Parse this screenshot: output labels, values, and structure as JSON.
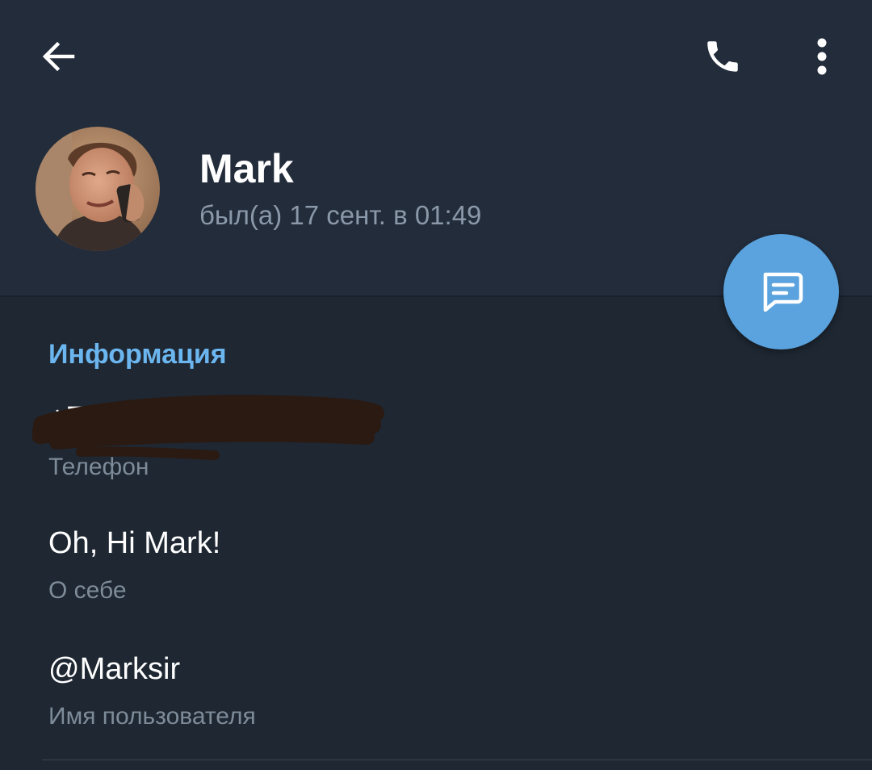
{
  "toolbar": {
    "back_icon": "arrow-left-icon",
    "call_icon": "phone-icon",
    "more_icon": "more-vertical-icon"
  },
  "profile": {
    "name": "Mark",
    "status": "был(а) 17 сент. в 01:49"
  },
  "fab": {
    "icon": "message-icon",
    "color": "#5aa3de"
  },
  "info": {
    "section_title": "Информация",
    "phone": {
      "value": "+7",
      "label": "Телефон"
    },
    "about": {
      "value": "Oh, Hi Mark!",
      "label": "О себе"
    },
    "username": {
      "value": "@Marksir",
      "label": "Имя пользователя"
    }
  },
  "colors": {
    "header_bg": "#222c3b",
    "body_bg": "#1e2732",
    "accent": "#6cb6f0"
  }
}
